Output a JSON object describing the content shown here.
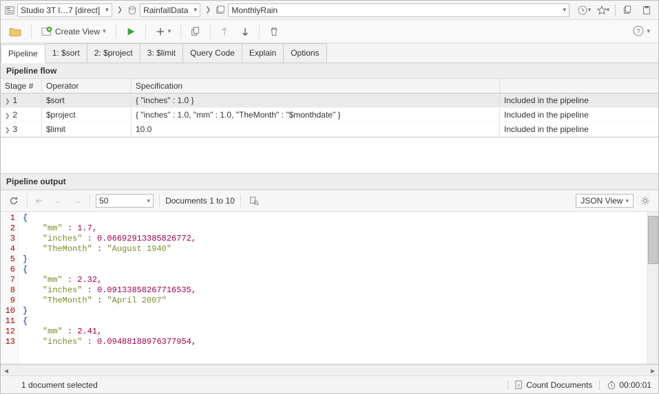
{
  "breadcrumb": {
    "connection": "Studio 3T l…7 [direct]",
    "db": "RainfallData",
    "collection": "MonthlyRain"
  },
  "toolbar": {
    "create_view": "Create View"
  },
  "tabs": [
    {
      "label": "Pipeline",
      "active": true
    },
    {
      "label": "1: $sort"
    },
    {
      "label": "2: $project"
    },
    {
      "label": "3: $limit"
    },
    {
      "label": "Query Code"
    },
    {
      "label": "Explain"
    },
    {
      "label": "Options"
    }
  ],
  "pipeline_flow": {
    "title": "Pipeline flow",
    "columns": {
      "stage": "Stage #",
      "operator": "Operator",
      "spec": "Specification",
      "status": ""
    },
    "rows": [
      {
        "num": "1",
        "op": "$sort",
        "spec": "{ \"inches\" : 1.0 }",
        "status": "Included in the pipeline",
        "sel": true
      },
      {
        "num": "2",
        "op": "$project",
        "spec": "{ \"inches\" : 1.0, \"mm\" : 1.0, \"TheMonth\" : \"$monthdate\" }",
        "status": "Included in the pipeline"
      },
      {
        "num": "3",
        "op": "$limit",
        "spec": "10.0",
        "status": "Included in the pipeline"
      }
    ]
  },
  "output": {
    "title": "Pipeline output",
    "page_size": "50",
    "doc_range": "Documents 1 to 10",
    "view_mode": "JSON View"
  },
  "code": {
    "lines": 13,
    "tokens": [
      [
        [
          "brace",
          "{"
        ]
      ],
      [
        [
          "pad",
          "    "
        ],
        [
          "key",
          "\"mm\""
        ],
        [
          "punc",
          " : "
        ],
        [
          "num",
          "1.7"
        ],
        [
          "punc",
          ","
        ]
      ],
      [
        [
          "pad",
          "    "
        ],
        [
          "key",
          "\"inches\""
        ],
        [
          "punc",
          " : "
        ],
        [
          "num",
          "0.06692913385826772"
        ],
        [
          "punc",
          ","
        ]
      ],
      [
        [
          "pad",
          "    "
        ],
        [
          "key",
          "\"TheMonth\""
        ],
        [
          "punc",
          " : "
        ],
        [
          "str",
          "\"August 1940\""
        ]
      ],
      [
        [
          "brace",
          "}"
        ]
      ],
      [
        [
          "brace",
          "{"
        ]
      ],
      [
        [
          "pad",
          "    "
        ],
        [
          "key",
          "\"mm\""
        ],
        [
          "punc",
          " : "
        ],
        [
          "num",
          "2.32"
        ],
        [
          "punc",
          ","
        ]
      ],
      [
        [
          "pad",
          "    "
        ],
        [
          "key",
          "\"inches\""
        ],
        [
          "punc",
          " : "
        ],
        [
          "num",
          "0.09133858267716535"
        ],
        [
          "punc",
          ","
        ]
      ],
      [
        [
          "pad",
          "    "
        ],
        [
          "key",
          "\"TheMonth\""
        ],
        [
          "punc",
          " : "
        ],
        [
          "str",
          "\"April 2007\""
        ]
      ],
      [
        [
          "brace",
          "}"
        ]
      ],
      [
        [
          "brace",
          "{"
        ]
      ],
      [
        [
          "pad",
          "    "
        ],
        [
          "key",
          "\"mm\""
        ],
        [
          "punc",
          " : "
        ],
        [
          "num",
          "2.41"
        ],
        [
          "punc",
          ","
        ]
      ],
      [
        [
          "pad",
          "    "
        ],
        [
          "key",
          "\"inches\""
        ],
        [
          "punc",
          " : "
        ],
        [
          "num",
          "0.09488188976377954"
        ],
        [
          "punc",
          ","
        ]
      ]
    ]
  },
  "status": {
    "selection": "1 document selected",
    "count_docs": "Count Documents",
    "elapsed": "00:00:01"
  }
}
